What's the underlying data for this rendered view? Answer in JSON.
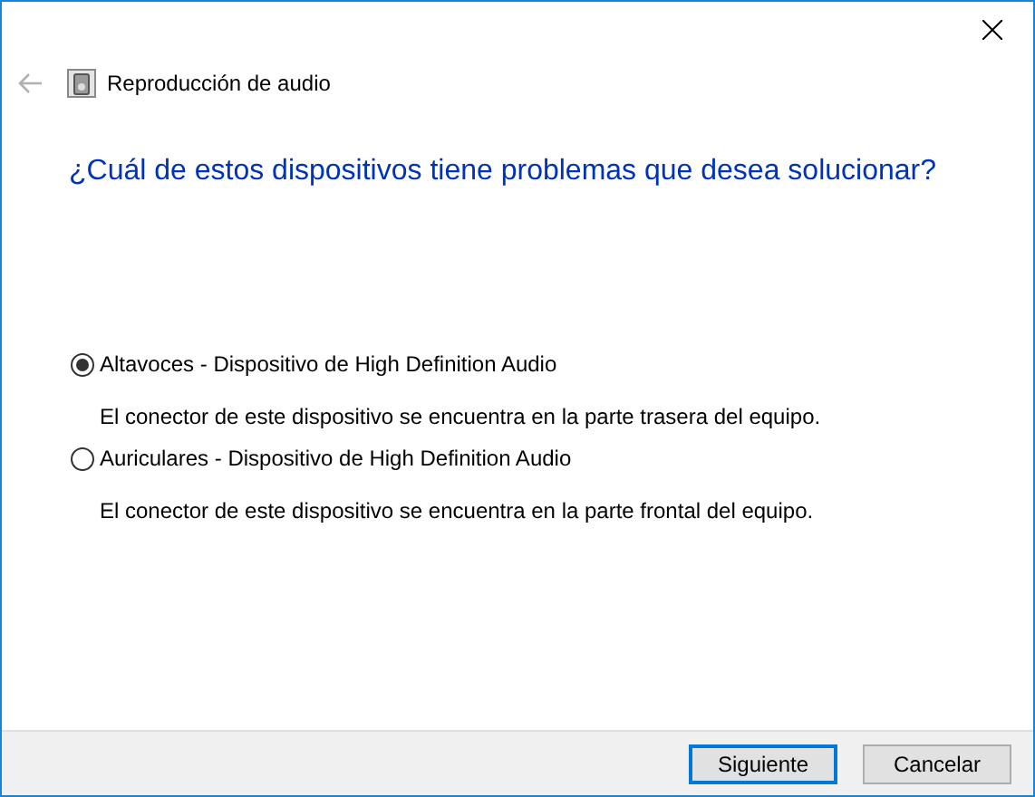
{
  "window": {
    "title": "Reproducción de audio",
    "back_disabled": true
  },
  "heading": "¿Cuál de estos dispositivos tiene problemas que desea solucionar?",
  "options": [
    {
      "label": "Altavoces - Dispositivo de High Definition Audio",
      "description": "El conector de este dispositivo se encuentra en la parte trasera del equipo.",
      "selected": true
    },
    {
      "label": "Auriculares - Dispositivo de High Definition Audio",
      "description": "El conector de este dispositivo se encuentra en la parte frontal del equipo.",
      "selected": false
    }
  ],
  "buttons": [
    {
      "label": "Siguiente",
      "default": true
    },
    {
      "label": "Cancelar",
      "default": false
    }
  ]
}
